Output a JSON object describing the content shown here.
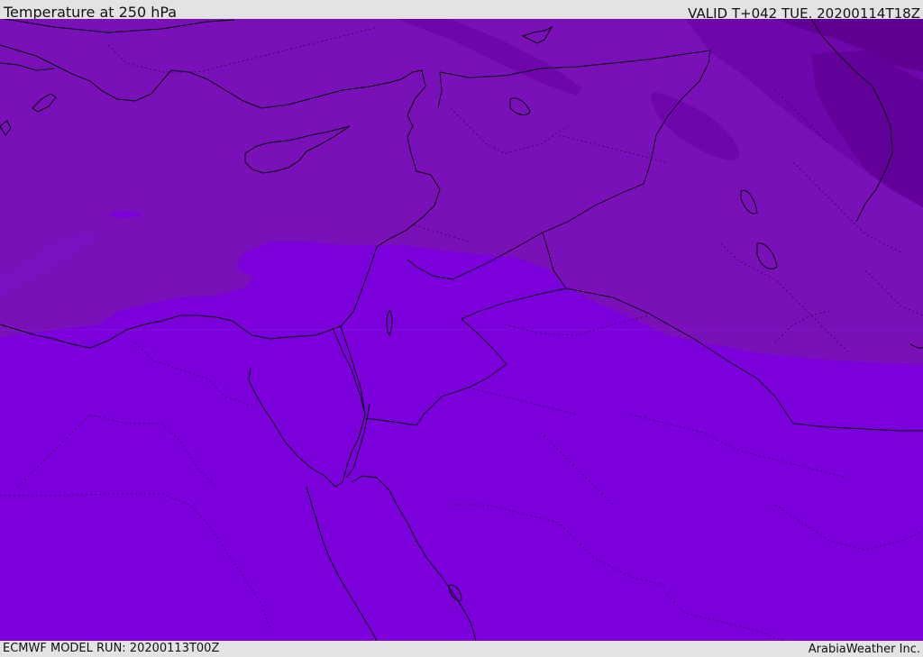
{
  "header": {
    "title": "Temperature at 250 hPa",
    "valid": "VALID T+042 TUE. 20200114T18Z"
  },
  "footer": {
    "model_run": "ECMWF MODEL RUN: 20200113T00Z",
    "credit": "ArabiaWeather Inc."
  },
  "colors": {
    "bar_background": "#e3e3e3",
    "band_warmest": "#7b00dc",
    "band_warm": "#7a10b8",
    "band_cool": "#7008ae",
    "band_coldest": "#5f0092",
    "coastline": "#000000",
    "borders": "#000000"
  }
}
